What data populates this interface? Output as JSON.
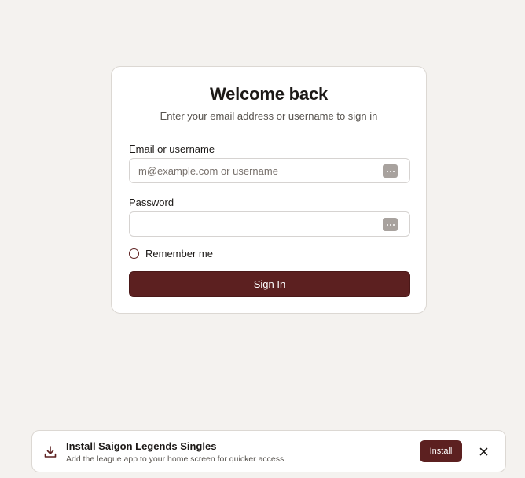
{
  "login": {
    "title": "Welcome back",
    "subtitle": "Enter your email address or username to sign in",
    "email_label": "Email or username",
    "email_placeholder": "m@example.com or username",
    "email_value": "",
    "password_label": "Password",
    "password_value": "",
    "remember_label": "Remember me",
    "remember_checked": false,
    "signin_label": "Sign In"
  },
  "install_banner": {
    "title": "Install Saigon Legends Singles",
    "subtitle": "Add the league app to your home screen for quicker access.",
    "install_label": "Install",
    "icon": "download-icon",
    "close_icon": "close-icon"
  },
  "colors": {
    "accent": "#5c2020",
    "background": "#f4f2ef",
    "card": "#ffffff"
  }
}
